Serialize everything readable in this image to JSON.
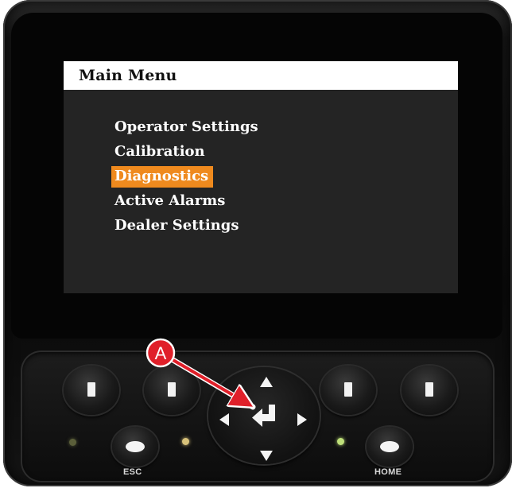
{
  "menu": {
    "title": "Main Menu",
    "items": [
      {
        "label": "Operator Settings",
        "selected": false
      },
      {
        "label": "Calibration",
        "selected": false
      },
      {
        "label": "Diagnostics",
        "selected": true
      },
      {
        "label": "Active Alarms",
        "selected": false
      },
      {
        "label": "Dealer Settings",
        "selected": false
      }
    ],
    "highlight_color": "#ef8a1e"
  },
  "keypad": {
    "esc_label": "ESC",
    "home_label": "HOME",
    "enter_icon": "enter-icon",
    "arrow_icons": [
      "arrow-up-icon",
      "arrow-down-icon",
      "arrow-left-icon",
      "arrow-right-icon"
    ],
    "led_colors": {
      "led_1": "#5b5f3a",
      "led_2": "#d8c27a",
      "led_3": "#bfe07a"
    }
  },
  "callout": {
    "label": "A",
    "color": "#e0202a"
  }
}
